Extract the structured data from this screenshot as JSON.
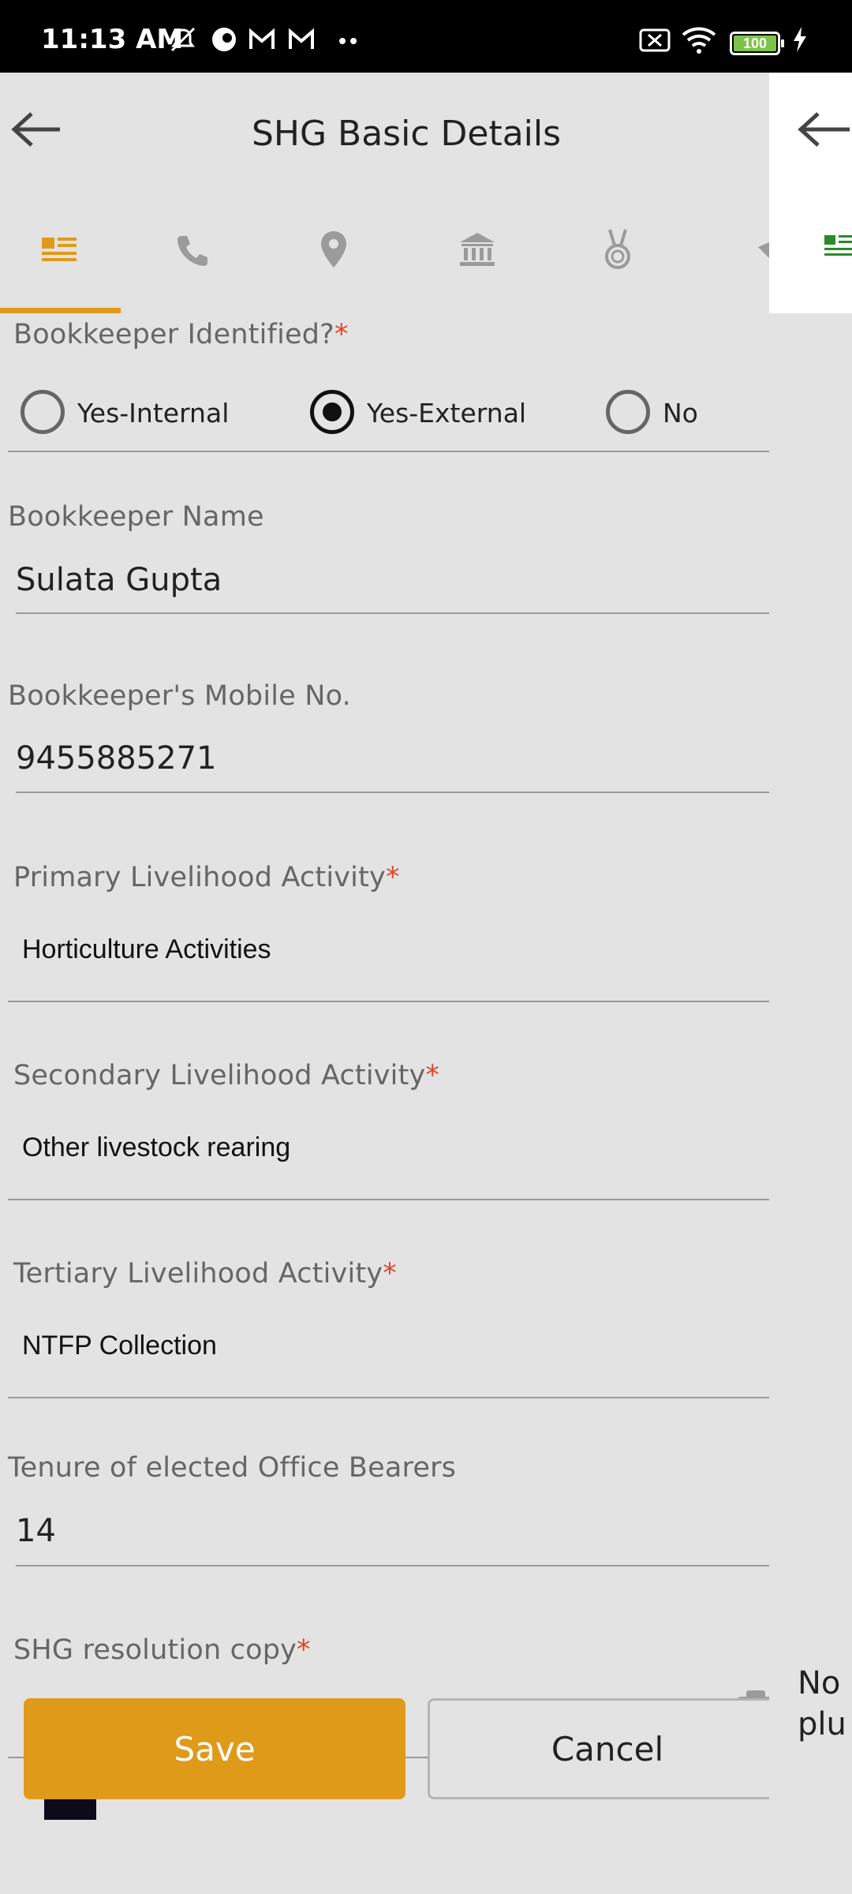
{
  "status_bar": {
    "time": "11:13 AM",
    "battery": "100"
  },
  "header": {
    "title": "SHG Basic Details"
  },
  "tabs": [
    {
      "name": "details",
      "active": true
    },
    {
      "name": "phone"
    },
    {
      "name": "location"
    },
    {
      "name": "bank"
    },
    {
      "name": "award"
    },
    {
      "name": "more"
    }
  ],
  "form": {
    "bookkeeper_identified": {
      "label": "Bookkeeper Identified?",
      "required_mark": "*",
      "options": [
        "Yes-Internal",
        "Yes-External",
        "No"
      ],
      "selected": "Yes-External"
    },
    "bookkeeper_name": {
      "label": "Bookkeeper Name",
      "value": "Sulata Gupta"
    },
    "bookkeeper_mobile": {
      "label": "Bookkeeper's Mobile No.",
      "value": "9455885271"
    },
    "primary_activity": {
      "label": "Primary Livelihood Activity",
      "required_mark": "*",
      "value": "Horticulture Activities"
    },
    "secondary_activity": {
      "label": "Secondary Livelihood Activity",
      "required_mark": "*",
      "value": "Other livestock rearing"
    },
    "tertiary_activity": {
      "label": "Tertiary Livelihood Activity",
      "required_mark": "*",
      "value": "NTFP Collection"
    },
    "tenure": {
      "label": "Tenure of elected Office Bearers",
      "value": "14"
    },
    "resolution_copy": {
      "label": "SHG resolution copy",
      "required_mark": "*"
    }
  },
  "buttons": {
    "save": "Save",
    "cancel": "Cancel"
  },
  "peek_panel": {
    "line1": "No",
    "line2": "plu"
  },
  "colors": {
    "accent": "#e09a1a",
    "required": "#e0452a",
    "background": "#e3e3e3"
  }
}
